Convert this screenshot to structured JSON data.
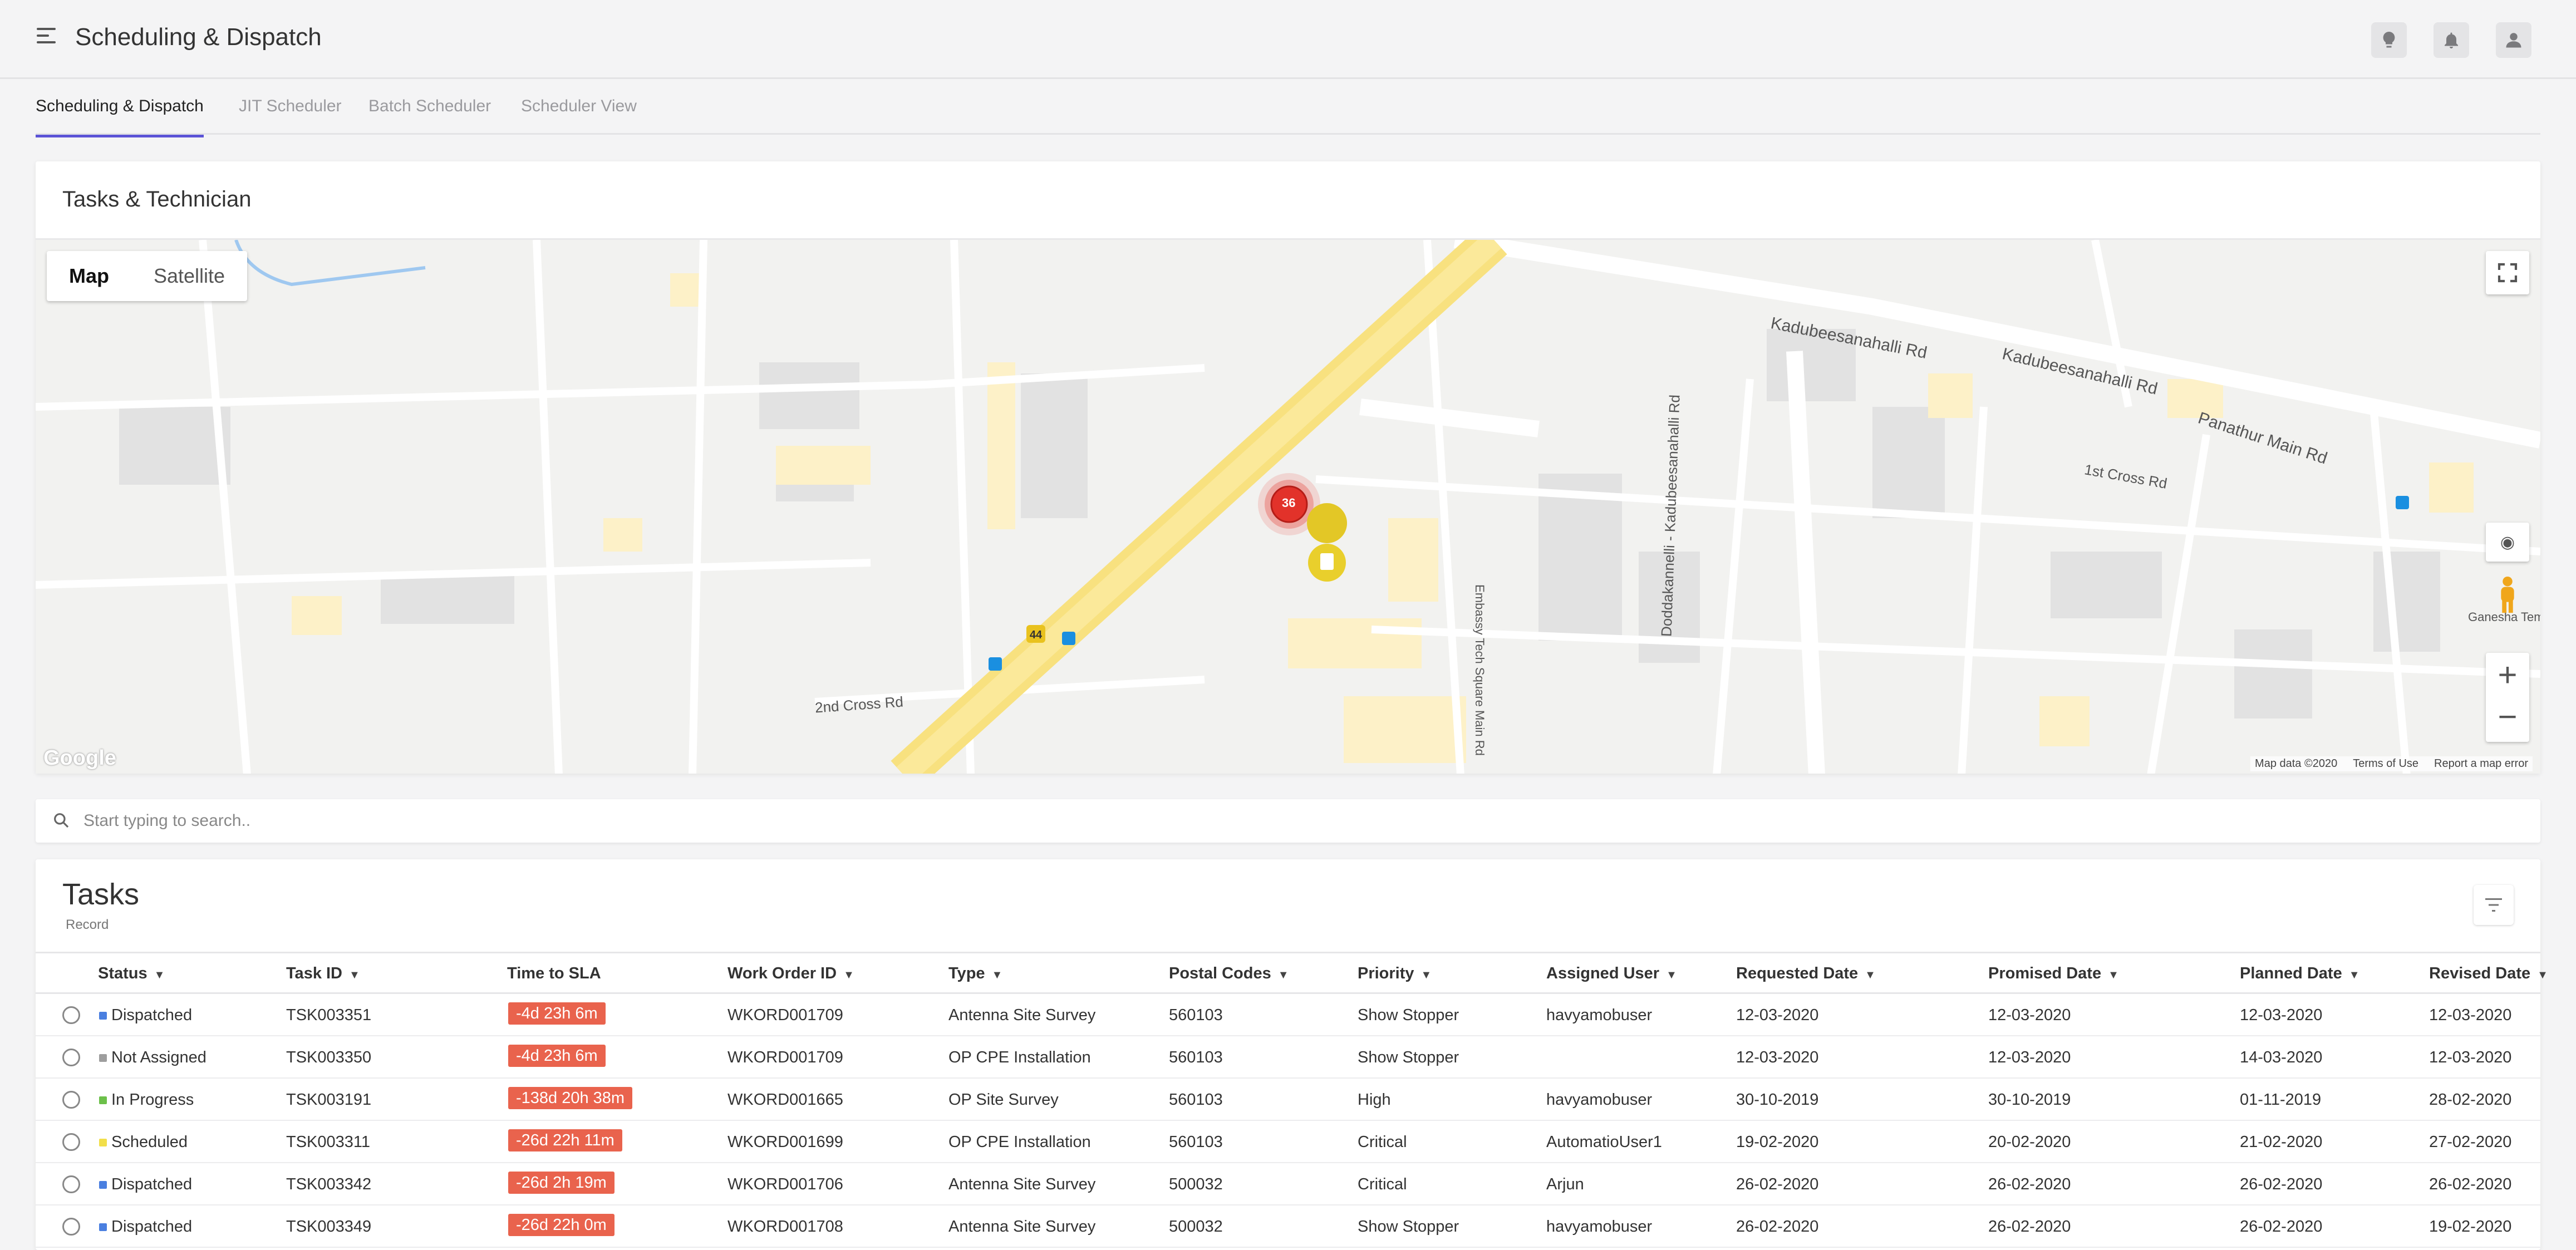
{
  "header": {
    "title": "Scheduling & Dispatch",
    "icons": [
      "lightbulb-icon",
      "bell-icon",
      "user-icon"
    ]
  },
  "tabs": [
    {
      "label": "Scheduling & Dispatch",
      "active": true
    },
    {
      "label": "JIT Scheduler",
      "active": false
    },
    {
      "label": "Batch Scheduler",
      "active": false
    },
    {
      "label": "Scheduler View",
      "active": false
    }
  ],
  "map_card": {
    "title": "Tasks & Technician",
    "map_type": {
      "map": "Map",
      "satellite": "Satellite",
      "selected": "Map"
    },
    "cluster_count": "36",
    "road_labels": {
      "r1": "Kadubeesanahalli Rd",
      "r2": "Kadubeesanahalli Rd",
      "r3": "Panathur Main Rd",
      "r4": "Doddakannelli - Kadubeesanahalli Rd",
      "r5": "2nd Cross Rd",
      "r6": "1st Cross Rd",
      "r7": "Embassy Tech Square Main Rd",
      "r8": "Ganesha Temple",
      "r9": "44"
    },
    "attribution": {
      "map_data": "Map data ©2020",
      "terms": "Terms of Use",
      "report": "Report a map error"
    },
    "logo": "Google"
  },
  "search": {
    "placeholder": "Start typing to search.."
  },
  "tasks": {
    "title": "Tasks",
    "subtitle": "Record",
    "columns": [
      "Status",
      "Task ID",
      "Time to SLA",
      "Work Order ID",
      "Type",
      "Postal Codes",
      "Priority",
      "Assigned User",
      "Requested Date",
      "Promised Date",
      "Planned Date",
      "Revised Date"
    ],
    "status_colors": {
      "Dispatched": "#4a7fe0",
      "Not Assigned": "#9e9e9e",
      "In Progress": "#6cc04a",
      "Scheduled": "#f2df4a"
    },
    "sla_color": "#e9634d",
    "rows": [
      {
        "status": "Dispatched",
        "task_id": "TSK003351",
        "sla": "-4d 23h 6m",
        "work_order": "WKORD001709",
        "type": "Antenna Site Survey",
        "postal": "560103",
        "priority": "Show Stopper",
        "user": "havyamobuser",
        "requested": "12-03-2020",
        "promised": "12-03-2020",
        "planned": "12-03-2020",
        "revised": "12-03-2020"
      },
      {
        "status": "Not Assigned",
        "task_id": "TSK003350",
        "sla": "-4d 23h 6m",
        "work_order": "WKORD001709",
        "type": "OP CPE Installation",
        "postal": "560103",
        "priority": "Show Stopper",
        "user": "",
        "requested": "12-03-2020",
        "promised": "12-03-2020",
        "planned": "14-03-2020",
        "revised": "12-03-2020"
      },
      {
        "status": "In Progress",
        "task_id": "TSK003191",
        "sla": "-138d 20h 38m",
        "work_order": "WKORD001665",
        "type": "OP Site Survey",
        "postal": "560103",
        "priority": "High",
        "user": "havyamobuser",
        "requested": "30-10-2019",
        "promised": "30-10-2019",
        "planned": "01-11-2019",
        "revised": "28-02-2020"
      },
      {
        "status": "Scheduled",
        "task_id": "TSK003311",
        "sla": "-26d 22h 11m",
        "work_order": "WKORD001699",
        "type": "OP CPE Installation",
        "postal": "560103",
        "priority": "Critical",
        "user": "AutomatioUser1",
        "requested": "19-02-2020",
        "promised": "20-02-2020",
        "planned": "21-02-2020",
        "revised": "27-02-2020"
      },
      {
        "status": "Dispatched",
        "task_id": "TSK003342",
        "sla": "-26d 2h 19m",
        "work_order": "WKORD001706",
        "type": "Antenna Site Survey",
        "postal": "500032",
        "priority": "Critical",
        "user": "Arjun",
        "requested": "26-02-2020",
        "promised": "26-02-2020",
        "planned": "26-02-2020",
        "revised": "26-02-2020"
      },
      {
        "status": "Dispatched",
        "task_id": "TSK003349",
        "sla": "-26d 22h 0m",
        "work_order": "WKORD001708",
        "type": "Antenna Site Survey",
        "postal": "500032",
        "priority": "Show Stopper",
        "user": "havyamobuser",
        "requested": "26-02-2020",
        "promised": "26-02-2020",
        "planned": "26-02-2020",
        "revised": "19-02-2020"
      }
    ]
  }
}
